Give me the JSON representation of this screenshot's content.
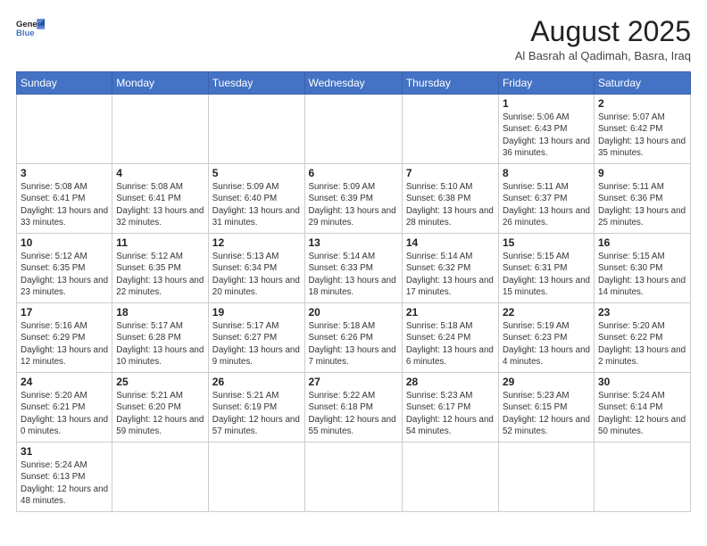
{
  "header": {
    "logo_line1": "General",
    "logo_line2": "Blue",
    "title": "August 2025",
    "subtitle": "Al Basrah al Qadimah, Basra, Iraq"
  },
  "weekdays": [
    "Sunday",
    "Monday",
    "Tuesday",
    "Wednesday",
    "Thursday",
    "Friday",
    "Saturday"
  ],
  "weeks": [
    [
      {
        "day": "",
        "info": ""
      },
      {
        "day": "",
        "info": ""
      },
      {
        "day": "",
        "info": ""
      },
      {
        "day": "",
        "info": ""
      },
      {
        "day": "",
        "info": ""
      },
      {
        "day": "1",
        "info": "Sunrise: 5:06 AM\nSunset: 6:43 PM\nDaylight: 13 hours and 36 minutes."
      },
      {
        "day": "2",
        "info": "Sunrise: 5:07 AM\nSunset: 6:42 PM\nDaylight: 13 hours and 35 minutes."
      }
    ],
    [
      {
        "day": "3",
        "info": "Sunrise: 5:08 AM\nSunset: 6:41 PM\nDaylight: 13 hours and 33 minutes."
      },
      {
        "day": "4",
        "info": "Sunrise: 5:08 AM\nSunset: 6:41 PM\nDaylight: 13 hours and 32 minutes."
      },
      {
        "day": "5",
        "info": "Sunrise: 5:09 AM\nSunset: 6:40 PM\nDaylight: 13 hours and 31 minutes."
      },
      {
        "day": "6",
        "info": "Sunrise: 5:09 AM\nSunset: 6:39 PM\nDaylight: 13 hours and 29 minutes."
      },
      {
        "day": "7",
        "info": "Sunrise: 5:10 AM\nSunset: 6:38 PM\nDaylight: 13 hours and 28 minutes."
      },
      {
        "day": "8",
        "info": "Sunrise: 5:11 AM\nSunset: 6:37 PM\nDaylight: 13 hours and 26 minutes."
      },
      {
        "day": "9",
        "info": "Sunrise: 5:11 AM\nSunset: 6:36 PM\nDaylight: 13 hours and 25 minutes."
      }
    ],
    [
      {
        "day": "10",
        "info": "Sunrise: 5:12 AM\nSunset: 6:35 PM\nDaylight: 13 hours and 23 minutes."
      },
      {
        "day": "11",
        "info": "Sunrise: 5:12 AM\nSunset: 6:35 PM\nDaylight: 13 hours and 22 minutes."
      },
      {
        "day": "12",
        "info": "Sunrise: 5:13 AM\nSunset: 6:34 PM\nDaylight: 13 hours and 20 minutes."
      },
      {
        "day": "13",
        "info": "Sunrise: 5:14 AM\nSunset: 6:33 PM\nDaylight: 13 hours and 18 minutes."
      },
      {
        "day": "14",
        "info": "Sunrise: 5:14 AM\nSunset: 6:32 PM\nDaylight: 13 hours and 17 minutes."
      },
      {
        "day": "15",
        "info": "Sunrise: 5:15 AM\nSunset: 6:31 PM\nDaylight: 13 hours and 15 minutes."
      },
      {
        "day": "16",
        "info": "Sunrise: 5:15 AM\nSunset: 6:30 PM\nDaylight: 13 hours and 14 minutes."
      }
    ],
    [
      {
        "day": "17",
        "info": "Sunrise: 5:16 AM\nSunset: 6:29 PM\nDaylight: 13 hours and 12 minutes."
      },
      {
        "day": "18",
        "info": "Sunrise: 5:17 AM\nSunset: 6:28 PM\nDaylight: 13 hours and 10 minutes."
      },
      {
        "day": "19",
        "info": "Sunrise: 5:17 AM\nSunset: 6:27 PM\nDaylight: 13 hours and 9 minutes."
      },
      {
        "day": "20",
        "info": "Sunrise: 5:18 AM\nSunset: 6:26 PM\nDaylight: 13 hours and 7 minutes."
      },
      {
        "day": "21",
        "info": "Sunrise: 5:18 AM\nSunset: 6:24 PM\nDaylight: 13 hours and 6 minutes."
      },
      {
        "day": "22",
        "info": "Sunrise: 5:19 AM\nSunset: 6:23 PM\nDaylight: 13 hours and 4 minutes."
      },
      {
        "day": "23",
        "info": "Sunrise: 5:20 AM\nSunset: 6:22 PM\nDaylight: 13 hours and 2 minutes."
      }
    ],
    [
      {
        "day": "24",
        "info": "Sunrise: 5:20 AM\nSunset: 6:21 PM\nDaylight: 13 hours and 0 minutes."
      },
      {
        "day": "25",
        "info": "Sunrise: 5:21 AM\nSunset: 6:20 PM\nDaylight: 12 hours and 59 minutes."
      },
      {
        "day": "26",
        "info": "Sunrise: 5:21 AM\nSunset: 6:19 PM\nDaylight: 12 hours and 57 minutes."
      },
      {
        "day": "27",
        "info": "Sunrise: 5:22 AM\nSunset: 6:18 PM\nDaylight: 12 hours and 55 minutes."
      },
      {
        "day": "28",
        "info": "Sunrise: 5:23 AM\nSunset: 6:17 PM\nDaylight: 12 hours and 54 minutes."
      },
      {
        "day": "29",
        "info": "Sunrise: 5:23 AM\nSunset: 6:15 PM\nDaylight: 12 hours and 52 minutes."
      },
      {
        "day": "30",
        "info": "Sunrise: 5:24 AM\nSunset: 6:14 PM\nDaylight: 12 hours and 50 minutes."
      }
    ],
    [
      {
        "day": "31",
        "info": "Sunrise: 5:24 AM\nSunset: 6:13 PM\nDaylight: 12 hours and 48 minutes."
      },
      {
        "day": "",
        "info": ""
      },
      {
        "day": "",
        "info": ""
      },
      {
        "day": "",
        "info": ""
      },
      {
        "day": "",
        "info": ""
      },
      {
        "day": "",
        "info": ""
      },
      {
        "day": "",
        "info": ""
      }
    ]
  ]
}
